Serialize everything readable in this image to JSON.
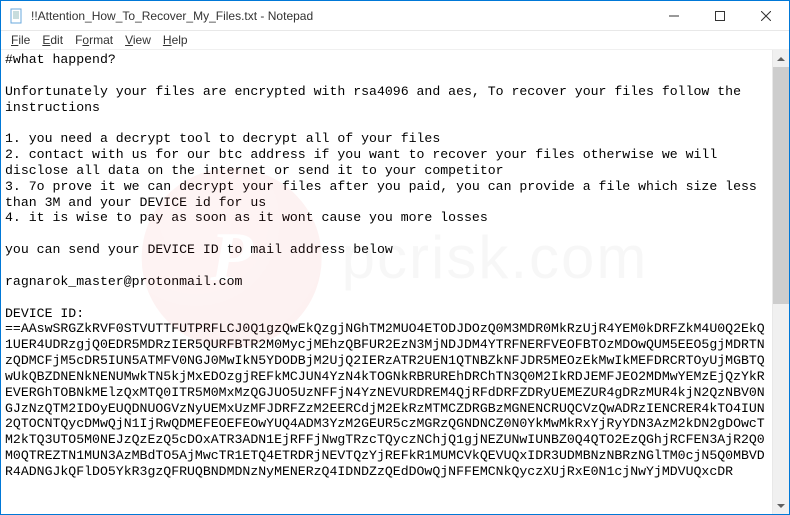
{
  "window": {
    "title": "!!Attention_How_To_Recover_My_Files.txt - Notepad"
  },
  "menu": {
    "items": [
      {
        "label": "File",
        "u": "F"
      },
      {
        "label": "Edit",
        "u": "E"
      },
      {
        "label": "Format",
        "u": "o"
      },
      {
        "label": "View",
        "u": "V"
      },
      {
        "label": "Help",
        "u": "H"
      }
    ]
  },
  "document": {
    "text": "#what happend?\n\nUnfortunately your files are encrypted with rsa4096 and aes, To recover your files follow the instructions\n\n1. you need a decrypt tool to decrypt all of your files\n2. contact with us for our btc address if you want to recover your files otherwise we will disclose all data on the internet or send it to your competitor\n3. 7o prove it we can decrypt your files after you paid, you can provide a file which size less than 3M and your DEVICE id for us\n4. it is wise to pay as soon as it wont cause you more losses\n\nyou can send your DEVICE ID to mail address below\n\nragnarok_master@protonmail.com\n\nDEVICE ID:\n==AAswSRGZkRVF0STVUTTFUTPRFLCJ0Q1gzQwEkQzgjNGhTM2MUO4ETODJDOzQ0M3MDR0MkRzUjR4YEM0kDRFZkM4U0Q2EkQ1UER4UDRzgjQ0EDR5MDRzIER5QURFBTR2M0MycjMEhzQBFUR2EzN3MjNDJDM4YTRFNERFVEOFBTOzMDOwQUM5EEO5gjMDRTNzQDMCFjM5cDR5IUN5ATMFV0NGJ0MwIkN5YDODBjM2UjQ2IERzATR2UEN1QTNBZkNFJDR5MEOzEkMwIkMEFDRCRTOyUjMGBTQwUkQBZDNENkNENUMwkTN5kjMxEDOzgjREFkMCJUN4YzN4kTOGNkRBRUREhDRChTN3Q0M2IkRDJEMFJEO2MDMwYEMzEjQzYkREVERGhTOBNkMElzQxMTQ0ITR5M0MxMzQGJUO5UzNFFjN4YzNEVURDREM4QjRFdDRFZDRyUEMEZUR4gDRzMUR4kjN2QzNBV0NGJzNzQTM2IDOyEUQDNUOGVzNyUEMxUzMFJDRFZzM2EERCdjM2EkRzMTMCZDRGBzMGNENCRUQCVzQwADRzIENCRER4kTO4IUN2QTOCNTQycDMwQjN1IjRwQDMEFEOEFEOwYUQ4ADM3YzM2GEUR5czMGRzQGNDNCZ0N0YkMwMkRxYjRyYDN3AzM2kDN2gDOwcTM2kTQ3UTO5M0NEJzQzEzQ5cDOxATR3ADN1EjRFFjNwgTRzcTQyczNChjQ1gjNEZUNwIUNBZ0Q4QTO2EzQGhjRCFEN3AjR2Q0M0QTREZTN1MUN3AzMBdTO5AjMwcTR1ETQ4ETRDRjNEVTQzYjREFkR1MUMCVkQEVUQxIDR3UDMBNzNBRzNGlTM0cjN5Q0MBVDR4ADNGJkQFlDO5YkR3gzQFRUQBNDMDNzNyMENERzQ4IDNDZzQEdDOwQjNFFEMCNkQyczXUjRxE0N1cjNwYjMDVUQxcDR"
  },
  "watermark": {
    "text": "pcrisk.com"
  }
}
